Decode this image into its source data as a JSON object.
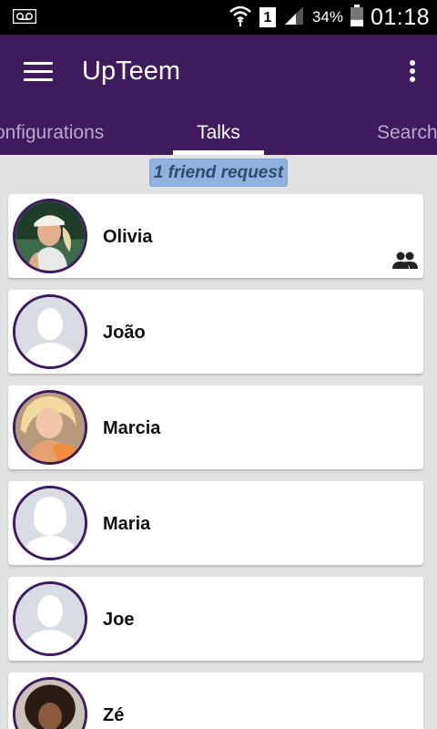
{
  "status_bar": {
    "left_icon": "voicemail-icon",
    "wifi_icon": "wifi-icon",
    "sim_slot": "1",
    "signal_icon": "signal-icon",
    "battery_percent": "34%",
    "battery_level": 0.34,
    "time": "01:18"
  },
  "app_bar": {
    "title": "UpTeem",
    "menu_icon": "menu-icon",
    "overflow_icon": "more-vert-icon"
  },
  "tabs": [
    {
      "label": "Configurations",
      "visible_text": "onfigurations"
    },
    {
      "label": "Talks",
      "visible_text": "Talks",
      "selected": true
    },
    {
      "label": "Search",
      "visible_text": "Search"
    }
  ],
  "friend_request": "1 friend request",
  "contacts": [
    {
      "name": "Olivia",
      "avatar": "photo",
      "friends_icon": true
    },
    {
      "name": "João",
      "avatar": "placeholder-male"
    },
    {
      "name": "Marcia",
      "avatar": "photo"
    },
    {
      "name": "Maria",
      "avatar": "placeholder-female"
    },
    {
      "name": "Joe",
      "avatar": "placeholder-male"
    },
    {
      "name": "Zé",
      "avatar": "photo"
    }
  ],
  "colors": {
    "primary": "#3e1b5c",
    "tab_inactive": "#b9a8cc",
    "badge_bg": "#8fb3de",
    "badge_text": "#2f4b6e",
    "background": "#e1e1e1"
  }
}
